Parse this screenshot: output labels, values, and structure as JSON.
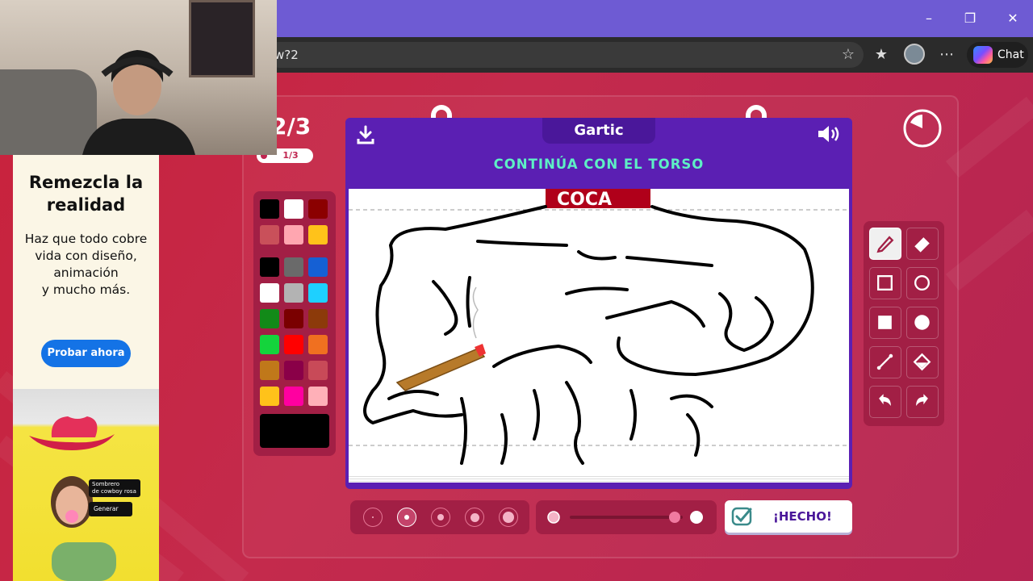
{
  "browser": {
    "url_fragment": "w?2",
    "chat_label": "Chat"
  },
  "ad": {
    "title": "Remezcla la realidad",
    "body_lines": [
      "Haz que todo cobre",
      "vida con diseño,",
      "animación",
      "y mucho más."
    ],
    "cta": "Probar ahora",
    "tag_line1": "Sombrero",
    "tag_line2": "de cowboy rosa",
    "tag_button": "Generar"
  },
  "game": {
    "round_counter": "2/3",
    "round_sub": "1/3",
    "logo": "Gartic",
    "prompt": "CONTINÚA CON EL TORSO",
    "done_label": "¡HECHO!",
    "palette": [
      "#000000",
      "#ffffff",
      "#8b0000",
      "#c9505a",
      "#ffa6b0",
      "#ffc21a",
      "#000000",
      "#6a6a6a",
      "#1560d4",
      "#ffffff",
      "#b3b3b3",
      "#1ed0ff",
      "#128a18",
      "#7a0000",
      "#8c3a0a",
      "#14d43c",
      "#ff0000",
      "#f07020",
      "#c0781a",
      "#8a0048",
      "#c84a58",
      "#ffc21a",
      "#ff00a0",
      "#ffb0b8"
    ],
    "current_color": "#000000",
    "canvas_text": "COCA",
    "brush_size_selected": 2,
    "opacity_level": 1
  }
}
